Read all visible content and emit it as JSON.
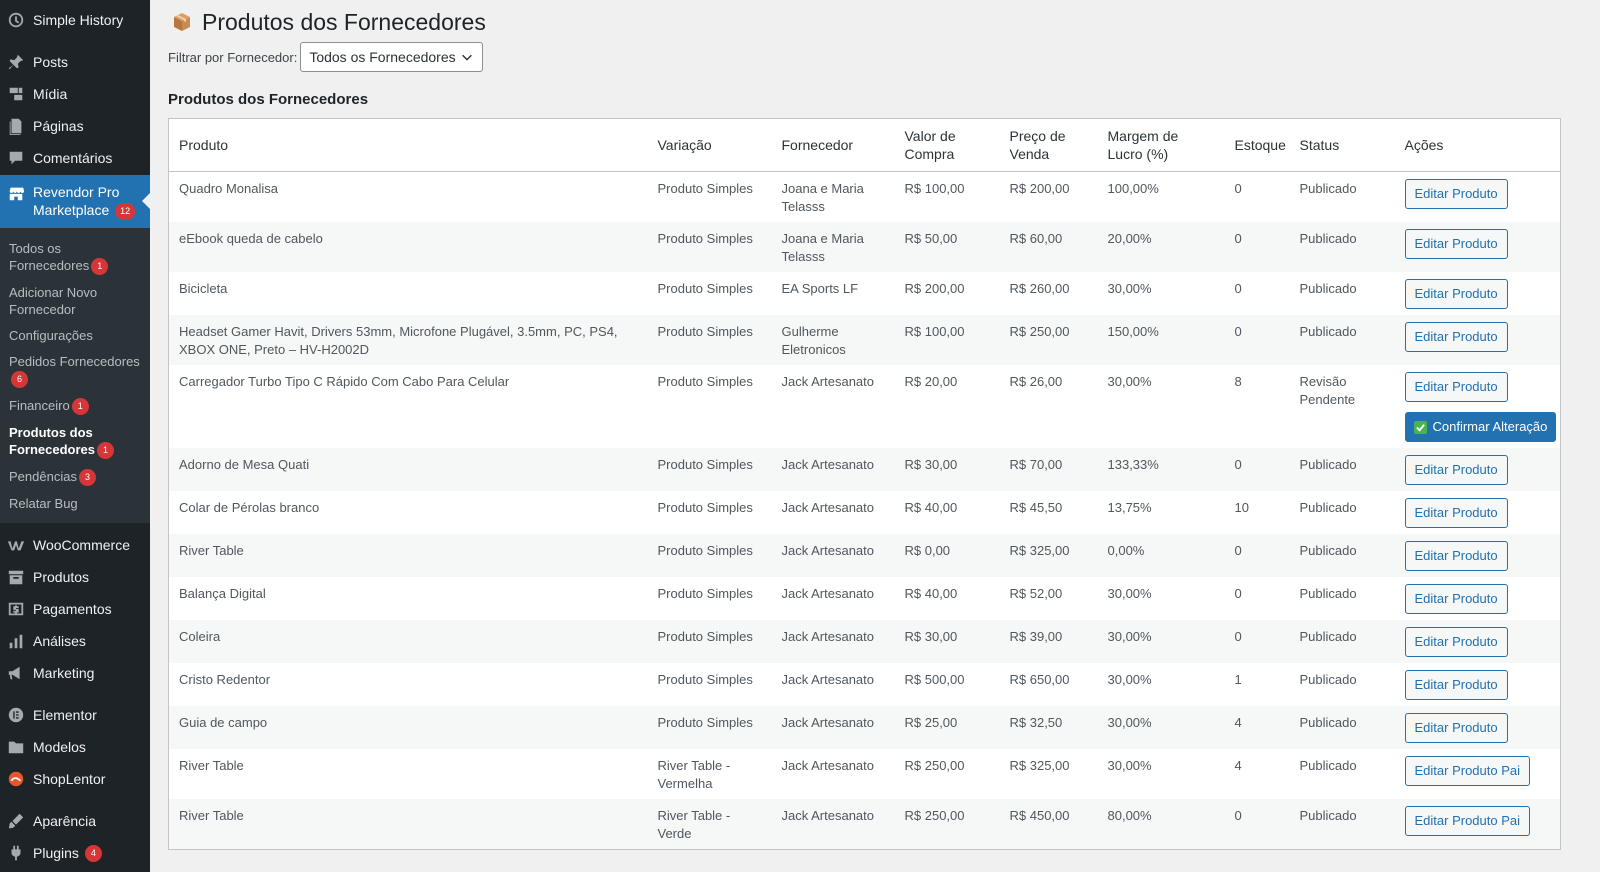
{
  "sidebar": {
    "top_items": [
      {
        "label": "Simple History",
        "icon": "history-icon"
      },
      {
        "label": "Posts",
        "icon": "pin-icon"
      },
      {
        "label": "Mídia",
        "icon": "media-icon"
      },
      {
        "label": "Páginas",
        "icon": "pages-icon"
      },
      {
        "label": "Comentários",
        "icon": "comments-icon"
      }
    ],
    "active_item": {
      "label": "Revendor Pro Marketplace",
      "badge": "12",
      "icon": "store-icon"
    },
    "submenu": [
      {
        "label": "Todos os Fornecedores",
        "badge": "1"
      },
      {
        "label": "Adicionar Novo Fornecedor",
        "badge": ""
      },
      {
        "label": "Configurações",
        "badge": ""
      },
      {
        "label": "Pedidos Fornecedores",
        "badge": "6"
      },
      {
        "label": "Financeiro",
        "badge": "1"
      },
      {
        "label": "Produtos dos Fornecedores",
        "badge": "1"
      },
      {
        "label": "Pendências",
        "badge": "3"
      },
      {
        "label": "Relatar Bug",
        "badge": ""
      }
    ],
    "bottom_items": [
      {
        "label": "WooCommerce",
        "icon": "woocommerce-icon"
      },
      {
        "label": "Produtos",
        "icon": "archive-icon"
      },
      {
        "label": "Pagamentos",
        "icon": "payments-icon"
      },
      {
        "label": "Análises",
        "icon": "chart-bar-icon"
      },
      {
        "label": "Marketing",
        "icon": "megaphone-icon"
      },
      {
        "label": "Elementor",
        "icon": "elementor-icon"
      },
      {
        "label": "Modelos",
        "icon": "folder-icon"
      },
      {
        "label": "ShopLentor",
        "icon": "shoplentor-icon"
      },
      {
        "label": "Aparência",
        "icon": "brush-icon"
      },
      {
        "label": "Plugins",
        "icon": "plugin-icon",
        "badge": "4"
      }
    ]
  },
  "page": {
    "title": "Produtos dos Fornecedores",
    "filter_label": "Filtrar por Fornecedor:",
    "filter_value": "Todos os Fornecedores",
    "section_title": "Produtos dos Fornecedores"
  },
  "table": {
    "headers": {
      "produto": "Produto",
      "variacao": "Variação",
      "fornecedor": "Fornecedor",
      "valor_compra": "Valor de Compra",
      "preco_venda": "Preço de Venda",
      "margem": "Margem de Lucro (%)",
      "estoque": "Estoque",
      "status": "Status",
      "acoes": "Ações"
    },
    "rows": [
      {
        "produto": "Quadro Monalisa",
        "variacao": "Produto Simples",
        "fornecedor": "Joana e Maria Telasss",
        "compra": "R$ 100,00",
        "venda": "R$ 200,00",
        "margem": "100,00%",
        "estoque": "0",
        "status": "Publicado",
        "acao": "Editar Produto",
        "confirm": ""
      },
      {
        "produto": "eEbook queda de cabelo",
        "variacao": "Produto Simples",
        "fornecedor": "Joana e Maria Telasss",
        "compra": "R$ 50,00",
        "venda": "R$ 60,00",
        "margem": "20,00%",
        "estoque": "0",
        "status": "Publicado",
        "acao": "Editar Produto",
        "confirm": ""
      },
      {
        "produto": "Bicicleta",
        "variacao": "Produto Simples",
        "fornecedor": "EA Sports LF",
        "compra": "R$ 200,00",
        "venda": "R$ 260,00",
        "margem": "30,00%",
        "estoque": "0",
        "status": "Publicado",
        "acao": "Editar Produto",
        "confirm": ""
      },
      {
        "produto": "Headset Gamer Havit, Drivers 53mm, Microfone Plugável, 3.5mm, PC, PS4, XBOX ONE, Preto – HV-H2002D",
        "variacao": "Produto Simples",
        "fornecedor": "Gulherme Eletronicos",
        "compra": "R$ 100,00",
        "venda": "R$ 250,00",
        "margem": "150,00%",
        "estoque": "0",
        "status": "Publicado",
        "acao": "Editar Produto",
        "confirm": ""
      },
      {
        "produto": "Carregador Turbo Tipo C Rápido Com Cabo Para Celular",
        "variacao": "Produto Simples",
        "fornecedor": "Jack Artesanato",
        "compra": "R$ 20,00",
        "venda": "R$ 26,00",
        "margem": "30,00%",
        "estoque": "8",
        "status": "Revisão Pendente",
        "acao": "Editar Produto",
        "confirm": "Confirmar Alteração"
      },
      {
        "produto": "Adorno de Mesa Quati",
        "variacao": "Produto Simples",
        "fornecedor": "Jack Artesanato",
        "compra": "R$ 30,00",
        "venda": "R$ 70,00",
        "margem": "133,33%",
        "estoque": "0",
        "status": "Publicado",
        "acao": "Editar Produto",
        "confirm": ""
      },
      {
        "produto": "Colar de Pérolas branco",
        "variacao": "Produto Simples",
        "fornecedor": "Jack Artesanato",
        "compra": "R$ 40,00",
        "venda": "R$ 45,50",
        "margem": "13,75%",
        "estoque": "10",
        "status": "Publicado",
        "acao": "Editar Produto",
        "confirm": ""
      },
      {
        "produto": "River Table",
        "variacao": "Produto Simples",
        "fornecedor": "Jack Artesanato",
        "compra": "R$ 0,00",
        "venda": "R$ 325,00",
        "margem": "0,00%",
        "estoque": "0",
        "status": "Publicado",
        "acao": "Editar Produto",
        "confirm": ""
      },
      {
        "produto": "Balança Digital",
        "variacao": "Produto Simples",
        "fornecedor": "Jack Artesanato",
        "compra": "R$ 40,00",
        "venda": "R$ 52,00",
        "margem": "30,00%",
        "estoque": "0",
        "status": "Publicado",
        "acao": "Editar Produto",
        "confirm": ""
      },
      {
        "produto": "Coleira",
        "variacao": "Produto Simples",
        "fornecedor": "Jack Artesanato",
        "compra": "R$ 30,00",
        "venda": "R$ 39,00",
        "margem": "30,00%",
        "estoque": "0",
        "status": "Publicado",
        "acao": "Editar Produto",
        "confirm": ""
      },
      {
        "produto": "Cristo Redentor",
        "variacao": "Produto Simples",
        "fornecedor": "Jack Artesanato",
        "compra": "R$ 500,00",
        "venda": "R$ 650,00",
        "margem": "30,00%",
        "estoque": "1",
        "status": "Publicado",
        "acao": "Editar Produto",
        "confirm": ""
      },
      {
        "produto": "Guia de campo",
        "variacao": "Produto Simples",
        "fornecedor": "Jack Artesanato",
        "compra": "R$ 25,00",
        "venda": "R$ 32,50",
        "margem": "30,00%",
        "estoque": "4",
        "status": "Publicado",
        "acao": "Editar Produto",
        "confirm": ""
      },
      {
        "produto": "River Table",
        "variacao": "River Table - Vermelha",
        "fornecedor": "Jack Artesanato",
        "compra": "R$ 250,00",
        "venda": "R$ 325,00",
        "margem": "30,00%",
        "estoque": "4",
        "status": "Publicado",
        "acao": "Editar Produto Pai",
        "confirm": ""
      },
      {
        "produto": "River Table",
        "variacao": "River Table - Verde",
        "fornecedor": "Jack Artesanato",
        "compra": "R$ 250,00",
        "venda": "R$ 450,00",
        "margem": "80,00%",
        "estoque": "0",
        "status": "Publicado",
        "acao": "Editar Produto Pai",
        "confirm": ""
      }
    ]
  }
}
